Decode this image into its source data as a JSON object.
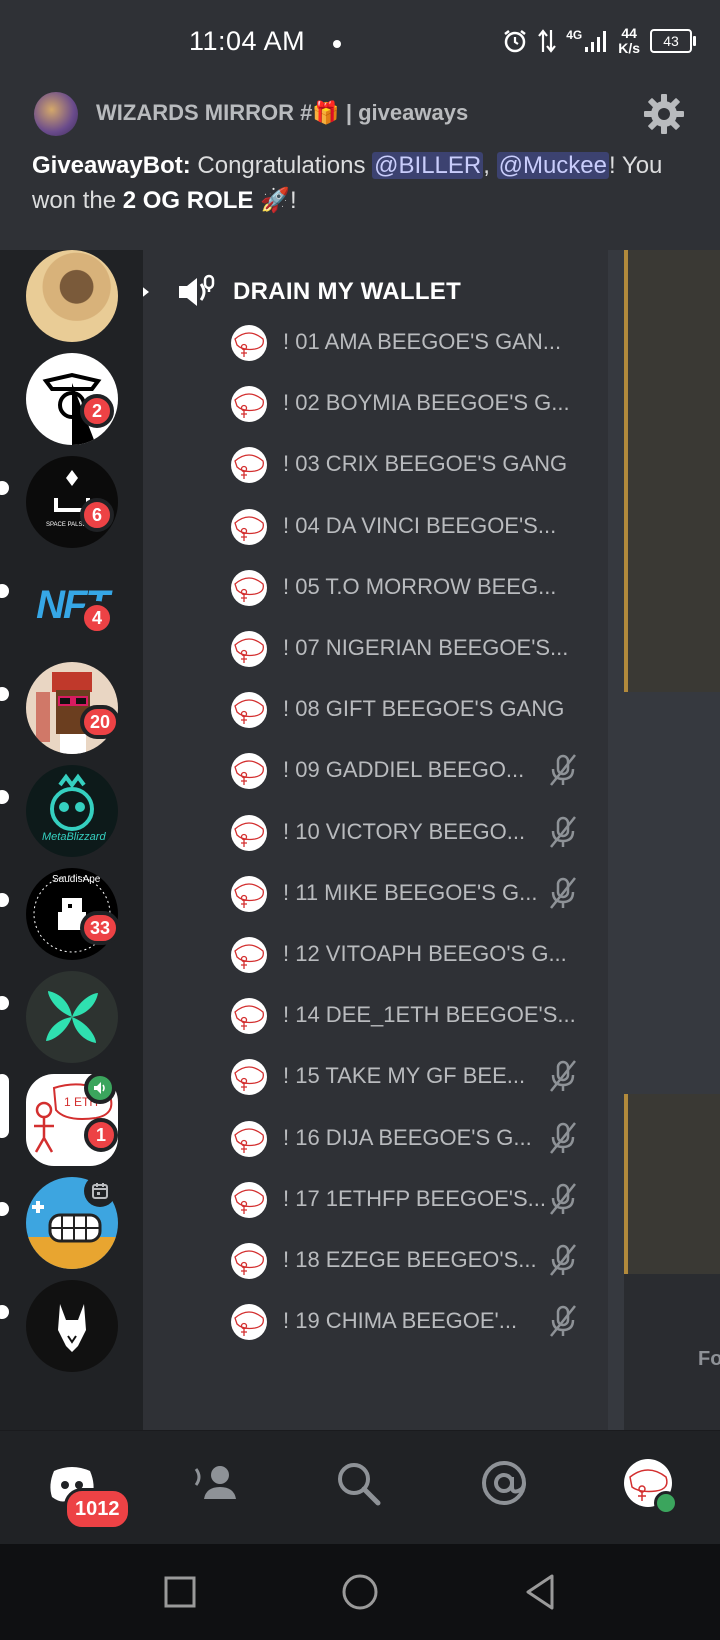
{
  "status": {
    "time": "11:04 AM",
    "network": "4G",
    "speed_value": "44",
    "speed_unit": "K/s",
    "battery": "43"
  },
  "notification": {
    "channel": "WIZARDS MIRROR #🎁 | giveaways",
    "sender": "GiveawayBot:",
    "text_before": " Congratulations ",
    "mention1": "@BILLER",
    "sep": ", ",
    "mention2": "@Muckee",
    "text_after": "! You won the ",
    "prize": "2 OG ROLE",
    "emoji": "🚀",
    "end": "!"
  },
  "servers": [
    {
      "name": "server-profile-photo",
      "badge": "",
      "color": "#c9a66b"
    },
    {
      "name": "server-mqc",
      "badge": "2",
      "color": "#ffffff"
    },
    {
      "name": "server-space-pulse",
      "badge": "6",
      "color": "#0b0b0b"
    },
    {
      "name": "server-nft",
      "badge": "4",
      "color": "#202225"
    },
    {
      "name": "server-pixel-avatar",
      "badge": "20",
      "color": "#e9d6c3"
    },
    {
      "name": "server-metablizzard",
      "badge": "",
      "color": "#0d1a1a"
    },
    {
      "name": "server-saudisape",
      "badge": "33",
      "color": "#000000"
    },
    {
      "name": "server-x-leaf",
      "badge": "",
      "color": "#2d3330"
    },
    {
      "name": "server-1eth",
      "badge": "1",
      "color": "#ffffff"
    },
    {
      "name": "server-grimace",
      "badge": "",
      "color": "#3da5e0"
    },
    {
      "name": "server-wolf",
      "badge": "",
      "color": "#111111"
    }
  ],
  "nft_label": "NFT",
  "space_pulse_label": "SPACE PALSE",
  "metablizzard_label": "MetaBlizzard",
  "saudis_label": "SaudisApe",
  "voice_channel": {
    "name": "DRAIN MY WALLET"
  },
  "voice_users": [
    {
      "name": "! 01 AMA BEEGOE'S GAN...",
      "muted": false
    },
    {
      "name": "! 02 BOYMIA BEEGOE'S G...",
      "muted": false
    },
    {
      "name": "! 03 CRIX BEEGOE'S GANG",
      "muted": false
    },
    {
      "name": "! 04 DA VINCI BEEGOE'S...",
      "muted": false
    },
    {
      "name": "! 05 T.O MORROW BEEG...",
      "muted": false
    },
    {
      "name": "! 07  NIGERIAN BEEGOE'S...",
      "muted": false
    },
    {
      "name": "! 08 GIFT BEEGOE'S GANG",
      "muted": false
    },
    {
      "name": "! 09 GADDIEL BEEGO...",
      "muted": true
    },
    {
      "name": "! 10 VICTORY BEEGO...",
      "muted": true
    },
    {
      "name": "! 11 MIKE BEEGOE'S G...",
      "muted": true
    },
    {
      "name": "! 12 VITOAPH BEEGO'S G...",
      "muted": false
    },
    {
      "name": "! 14 DEE_1ETH BEEGOE'S...",
      "muted": false
    },
    {
      "name": "! 15 TAKE MY GF BEE...",
      "muted": true
    },
    {
      "name": "! 16  DIJA BEEGOE'S G...",
      "muted": true
    },
    {
      "name": "! 17 1ETHFP BEEGOE'S...",
      "muted": true
    },
    {
      "name": "! 18 EZEGE BEEGEO'S...",
      "muted": true
    },
    {
      "name": "! 19 CHIMA BEEGOE'...",
      "muted": true
    }
  ],
  "right_partial_text": "Fo",
  "tabs": {
    "home_badge": "1012"
  },
  "colors": {
    "accent": "#5865f2",
    "badge_red": "#ed4245",
    "online_green": "#3ba55d"
  }
}
